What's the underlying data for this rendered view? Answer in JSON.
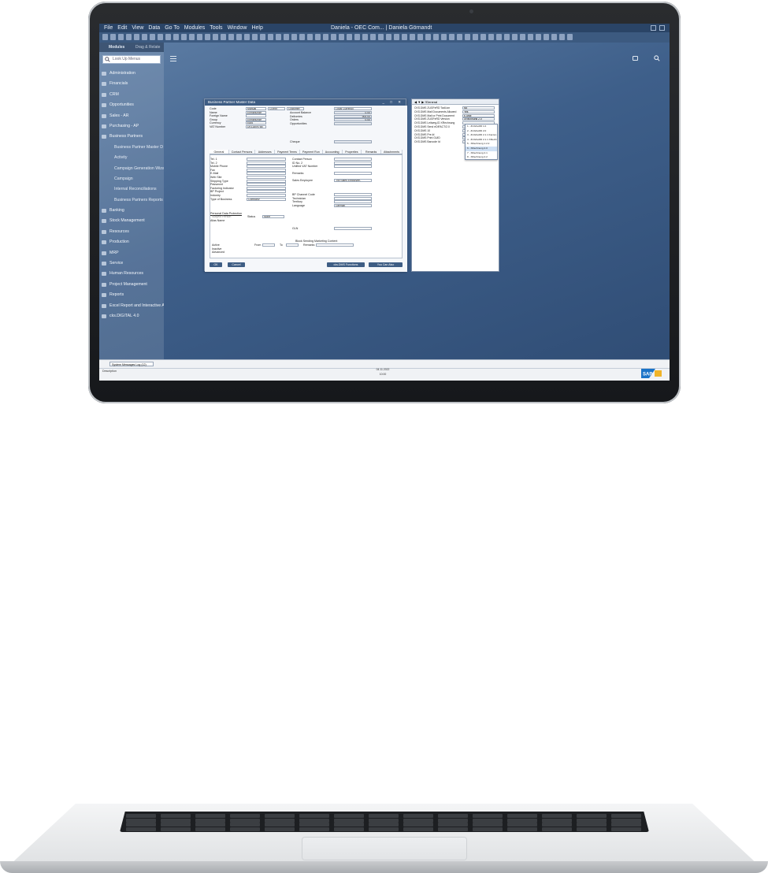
{
  "app": {
    "window_title": "Daniela - OEC Com... | Daniela Görnandt",
    "menu": [
      "File",
      "Edit",
      "View",
      "Data",
      "Go To",
      "Modules",
      "Tools",
      "Window",
      "Help"
    ]
  },
  "sidebar": {
    "tabs": [
      "Modules",
      "Drag & Relate"
    ],
    "search_placeholder": "Look Up Menus",
    "items": [
      {
        "label": "Administration",
        "sub": false
      },
      {
        "label": "Financials",
        "sub": false
      },
      {
        "label": "CRM",
        "sub": false
      },
      {
        "label": "Opportunities",
        "sub": false
      },
      {
        "label": "Sales - AR",
        "sub": false
      },
      {
        "label": "Purchasing - AP",
        "sub": false
      },
      {
        "label": "Business Partners",
        "sub": false
      },
      {
        "label": "Business Partner Master D",
        "sub": true
      },
      {
        "label": "Activity",
        "sub": true
      },
      {
        "label": "Campaign Generation Wiza",
        "sub": true
      },
      {
        "label": "Campaign",
        "sub": true
      },
      {
        "label": "Internal Reconciliations",
        "sub": true
      },
      {
        "label": "Business Partners Reports",
        "sub": true
      },
      {
        "label": "Banking",
        "sub": false
      },
      {
        "label": "Stock Management",
        "sub": false
      },
      {
        "label": "Resources",
        "sub": false
      },
      {
        "label": "Production",
        "sub": false
      },
      {
        "label": "MRP",
        "sub": false
      },
      {
        "label": "Service",
        "sub": false
      },
      {
        "label": "Human Resources",
        "sub": false
      },
      {
        "label": "Project Management",
        "sub": false
      },
      {
        "label": "Reports",
        "sub": false
      },
      {
        "label": "Excel Report and Interactive A",
        "sub": false
      },
      {
        "label": "cks.DIGITAL 4.0",
        "sub": false
      }
    ]
  },
  "bp_window": {
    "title": "Business Partner Master Data",
    "left_fields": [
      {
        "label": "Code",
        "value": "Manual"
      },
      {
        "label": "Name",
        "value": "Einnahunde"
      },
      {
        "label": "Foreign Name",
        "value": ""
      },
      {
        "label": "Group",
        "value": "Einnahunde"
      },
      {
        "label": "Currency",
        "value": "Euro"
      },
      {
        "label": "VAT Number",
        "value": "DE11809788"
      }
    ],
    "code_extra": [
      "C0999",
      "Customer"
    ],
    "right_fields": [
      {
        "label": "Account Balance",
        "value": "0,00"
      },
      {
        "label": "Deliveries",
        "value": "900,00"
      },
      {
        "label": "Orders",
        "value": "0,00"
      },
      {
        "label": "Opportunities",
        "value": ""
      }
    ],
    "currency_select": "Local Currency",
    "cheque_label": "Cheque",
    "tabs": [
      "General",
      "Contact Persons",
      "Addresses",
      "Payment Terms",
      "Payment Run",
      "Accounting",
      "Properties",
      "Remarks",
      "Attachments"
    ],
    "general_left": [
      {
        "label": "Tel. 1",
        "value": ""
      },
      {
        "label": "Tel. 2",
        "value": ""
      },
      {
        "label": "Mobile Phone",
        "value": ""
      },
      {
        "label": "Fax",
        "value": ""
      },
      {
        "label": "E-Mail",
        "value": ""
      },
      {
        "label": "Web Site",
        "value": ""
      },
      {
        "label": "Shipping Type",
        "value": ""
      },
      {
        "label": "Password",
        "value": ""
      },
      {
        "label": "Factoring Indicator",
        "value": ""
      },
      {
        "label": "BP Project",
        "value": ""
      },
      {
        "label": "Industry",
        "value": ""
      },
      {
        "label": "Type of Business",
        "value": "Company"
      }
    ],
    "general_right": [
      {
        "label": "Contact Person",
        "value": ""
      },
      {
        "label": "ID No. 2",
        "value": ""
      },
      {
        "label": "Unified VAT Number",
        "value": ""
      },
      {
        "label": "Remarks",
        "value": ""
      },
      {
        "label": "Sales Employee",
        "value": "-No Sales Employee-"
      },
      {
        "label": "BP Channel Code",
        "value": ""
      },
      {
        "label": "Technician",
        "value": ""
      },
      {
        "label": "Territory",
        "value": ""
      },
      {
        "label": "Language",
        "value": "German"
      }
    ],
    "gdpr_title": "Personal Data Protection",
    "subject_label": "Subject Person",
    "status_label": "Status",
    "status_value": "None",
    "alias_label": "Alias Name",
    "glob_label": "GLN",
    "block_label": "Block Sending Marketing Content",
    "radios": [
      "Active",
      "Inactive",
      "Advanced"
    ],
    "from_label": "From",
    "to_label": "To",
    "remarks_label": "Remarks",
    "buttons": {
      "ok": "OK",
      "cancel": "Cancel",
      "hub": "cks.DMS Functions",
      "you_can_also": "You Can Also"
    }
  },
  "udf_window": {
    "header": "General",
    "rows": [
      {
        "label": "CKS.DMS ZUGFeRD Tadl-ion",
        "value": "No"
      },
      {
        "label": "CKS.DMS Mail Documents Allowed",
        "value": "Yes"
      },
      {
        "label": "CKS.DMS Mail or Print Document",
        "value": "E-Mail"
      },
      {
        "label": "CKS.DMS ZUGFeRD Version",
        "value": "XRechnung 2.0"
      },
      {
        "label": "CKS.DMS Leitweg-ID XRechnung",
        "value": ""
      },
      {
        "label": "CKS.DMS Send eDIFACT/2.0",
        "value": ""
      },
      {
        "label": "CKS.DMS 10",
        "value": ""
      },
      {
        "label": "CKS.DMS Pre.Id",
        "value": ""
      },
      {
        "label": "CKS.DMS Print GUID",
        "value": ""
      },
      {
        "label": "CKS.DMS Barcode Id",
        "value": ""
      }
    ],
    "dropdown": [
      {
        "label": "1   -   ZUGFeRD 1.0",
        "selected": false
      },
      {
        "label": "2   -   ZUGFeRD 2.0",
        "selected": false
      },
      {
        "label": "3   -   ZUGFeRD 2.1.1 Factur-X",
        "selected": false
      },
      {
        "label": "4   -   ZUGFeRD 2.1.1 XRechnung 1.2.2",
        "selected": false
      },
      {
        "label": "5   -   XRechnung 1.2.2",
        "selected": false
      },
      {
        "label": "6   -   XRechnung 2.0",
        "selected": true
      },
      {
        "label": "7   -   XRechnung 2.1",
        "selected": false
      },
      {
        "label": "8   -   XRechnung 2.2",
        "selected": false
      }
    ]
  },
  "statusbar": {
    "tab": "System Messages Log (12)",
    "description": "Description",
    "date": "04.11.2022",
    "time": "10:00"
  }
}
